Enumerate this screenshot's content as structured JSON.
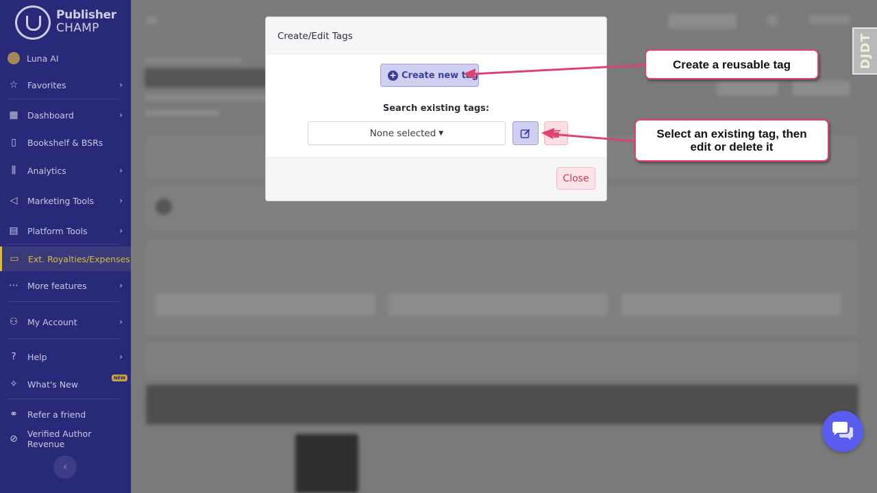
{
  "sidebar": {
    "logo": {
      "line1": "Publisher",
      "line2": "CHAMP"
    },
    "user": "Luna AI",
    "items": [
      {
        "label": "Favorites",
        "icon": "star-icon"
      },
      {
        "label": "Dashboard",
        "icon": "grid-icon"
      },
      {
        "label": "Bookshelf & BSRs",
        "icon": "book-icon"
      },
      {
        "label": "Analytics",
        "icon": "analytics-icon"
      },
      {
        "label": "Marketing Tools",
        "icon": "megaphone-icon"
      },
      {
        "label": "Platform Tools",
        "icon": "store-icon"
      },
      {
        "label": "Ext. Royalties/Expenses",
        "icon": "wallet-icon"
      },
      {
        "label": "More features",
        "icon": "ellipsis-icon"
      },
      {
        "label": "My Account",
        "icon": "user-gear-icon"
      },
      {
        "label": "Help",
        "icon": "help-icon"
      },
      {
        "label": "What's New",
        "icon": "sparkle-icon"
      },
      {
        "label": "Refer a friend",
        "icon": "users-icon"
      },
      {
        "label": "Verified Author Revenue",
        "icon": "check-circle-icon"
      }
    ],
    "new_badge": "NEW"
  },
  "modal": {
    "title": "Create/Edit Tags",
    "create_button": "Create new tag",
    "search_label": "Search existing tags:",
    "select_value": "None selected",
    "close_button": "Close"
  },
  "callouts": {
    "create": "Create a reusable tag",
    "edit_line1": "Select an existing tag, then",
    "edit_line2": "edit or delete it"
  },
  "watermark": "DJDT",
  "colors": {
    "sidebar_bg": "#29297a",
    "active": "#d8b94a",
    "callout_border": "#e0426f",
    "primary_soft": "#cfd0f1",
    "danger_soft": "#fbe3e8",
    "chat": "#5a5cf0"
  }
}
